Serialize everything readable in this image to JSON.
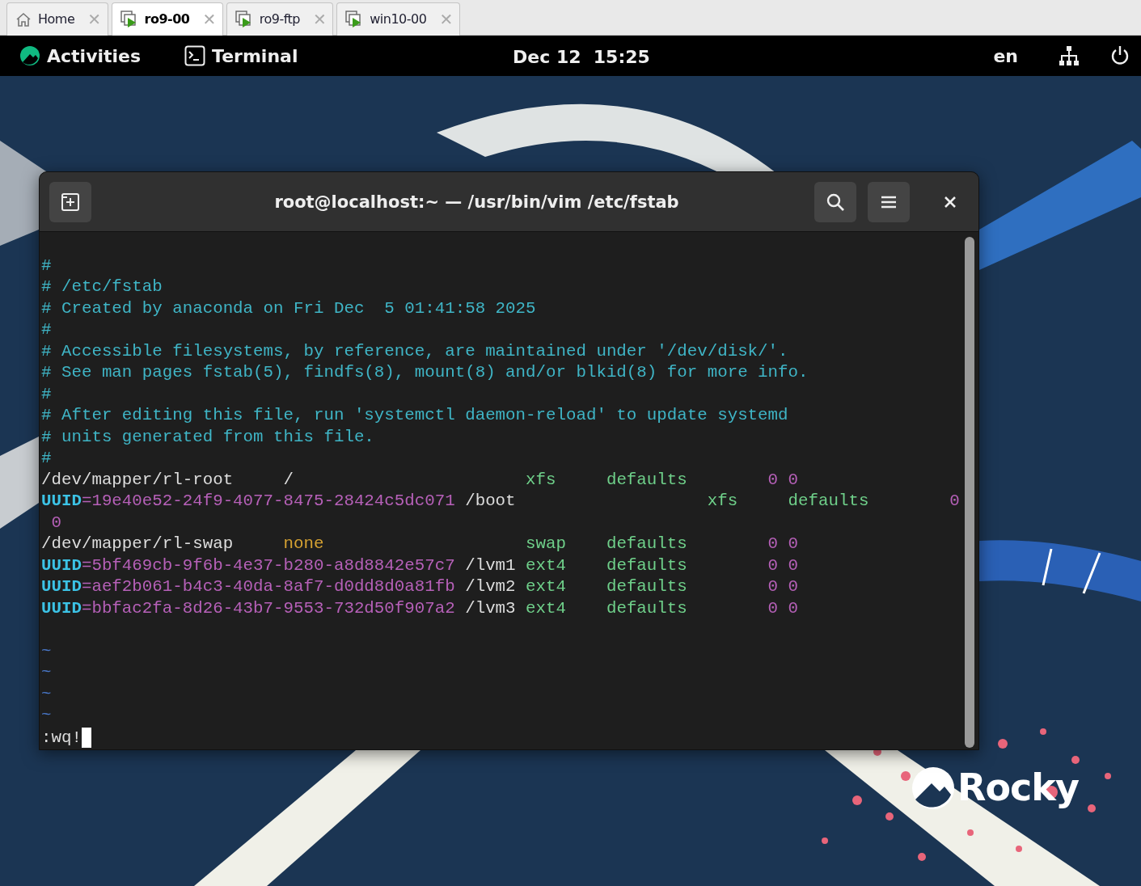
{
  "browser_tabs": [
    {
      "label": "Home",
      "kind": "home",
      "selected": false,
      "close": "✕"
    },
    {
      "label": "ro9-00",
      "kind": "vm",
      "selected": true,
      "close": "✕"
    },
    {
      "label": "ro9-ftp",
      "kind": "vm",
      "selected": false,
      "close": "✕"
    },
    {
      "label": "win10-00",
      "kind": "vm",
      "selected": false,
      "close": "✕"
    }
  ],
  "top_bar": {
    "activities": "Activities",
    "app": "Terminal",
    "clock": "Dec 12  15:25",
    "language": "en"
  },
  "terminal": {
    "title": "root@localhost:~ — /usr/bin/vim /etc/fstab",
    "blocks": [
      [
        [
          {
            "kind": "comment",
            "text": "#"
          }
        ],
        [
          {
            "kind": "comment",
            "text": "# /etc/fstab"
          }
        ],
        [
          {
            "kind": "comment",
            "text": "# Created by anaconda on Fri Dec  5 01:41:58 2025"
          }
        ],
        [
          {
            "kind": "comment",
            "text": "#"
          }
        ],
        [
          {
            "kind": "comment",
            "text": "# Accessible filesystems, by reference, are maintained under '/dev/disk/'."
          }
        ],
        [
          {
            "kind": "comment",
            "text": "# See man pages fstab(5), findfs(8), mount(8) and/or blkid(8) for more info."
          }
        ],
        [
          {
            "kind": "comment",
            "text": "#"
          }
        ],
        [
          {
            "kind": "comment",
            "text": "# After editing this file, run 'systemctl daemon-reload' to update systemd"
          }
        ],
        [
          {
            "kind": "comment",
            "text": "# units generated from this file."
          }
        ],
        [
          {
            "kind": "comment",
            "text": "#"
          }
        ],
        [
          {
            "kind": "plain",
            "text": "/dev/mapper/rl-root     /                       "
          },
          {
            "kind": "type",
            "text": "xfs     defaults        "
          },
          {
            "kind": "number",
            "text": "0 0"
          }
        ],
        [
          {
            "kind": "keyword",
            "text": "UUID"
          },
          {
            "kind": "value",
            "text": "=19e40e52-24f9-4077-8475-28424c5dc071"
          },
          {
            "kind": "plain",
            "text": " /boot                   "
          },
          {
            "kind": "type",
            "text": "xfs     defaults        "
          },
          {
            "kind": "number",
            "text": "0"
          }
        ],
        [
          {
            "kind": "number",
            "text": " 0"
          }
        ],
        [
          {
            "kind": "plain",
            "text": "/dev/mapper/rl-swap     "
          },
          {
            "kind": "special",
            "text": "none                    "
          },
          {
            "kind": "type",
            "text": "swap    defaults        "
          },
          {
            "kind": "number",
            "text": "0 0"
          }
        ],
        [
          {
            "kind": "keyword",
            "text": "UUID"
          },
          {
            "kind": "value",
            "text": "=5bf469cb-9f6b-4e37-b280-a8d8842e57c7"
          },
          {
            "kind": "plain",
            "text": " /lvm1 "
          },
          {
            "kind": "type",
            "text": "ext4    defaults        "
          },
          {
            "kind": "number",
            "text": "0 0"
          }
        ],
        [
          {
            "kind": "keyword",
            "text": "UUID"
          },
          {
            "kind": "value",
            "text": "=aef2b061-b4c3-40da-8af7-d0dd8d0a81fb"
          },
          {
            "kind": "plain",
            "text": " /lvm2 "
          },
          {
            "kind": "type",
            "text": "ext4    defaults        "
          },
          {
            "kind": "number",
            "text": "0 0"
          }
        ],
        [
          {
            "kind": "keyword",
            "text": "UUID"
          },
          {
            "kind": "value",
            "text": "=bbfac2fa-8d26-43b7-9553-732d50f907a2"
          },
          {
            "kind": "plain",
            "text": " /lvm3 "
          },
          {
            "kind": "type",
            "text": "ext4    defaults        "
          },
          {
            "kind": "number",
            "text": "0 0"
          }
        ]
      ],
      [
        [
          {
            "kind": "tilde",
            "text": "~"
          }
        ],
        [
          {
            "kind": "tilde",
            "text": "~"
          }
        ],
        [
          {
            "kind": "tilde",
            "text": "~"
          }
        ],
        [
          {
            "kind": "tilde",
            "text": "~"
          }
        ]
      ]
    ],
    "command": ":wq!"
  },
  "wallpaper": {
    "logo_text": "Rocky"
  }
}
